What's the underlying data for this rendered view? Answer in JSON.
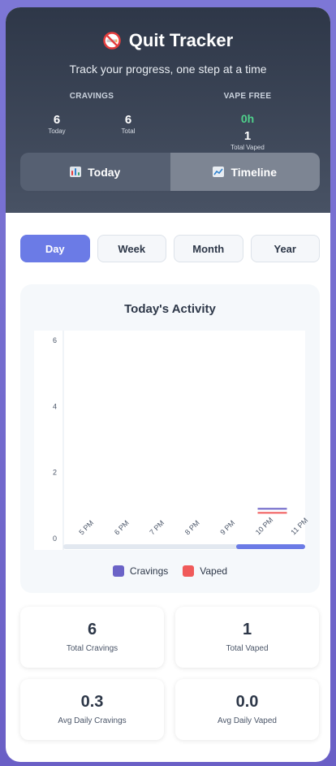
{
  "header": {
    "title": "Quit Tracker",
    "subtitle": "Track your progress, one step at a time",
    "cravings_label": "CRAVINGS",
    "vape_free_label": "VAPE FREE",
    "today_count": "6",
    "today_label": "Today",
    "total_count": "6",
    "total_label": "Total",
    "vape_free_time": "0h",
    "total_vaped_count": "1",
    "total_vaped_label": "Total Vaped"
  },
  "tabs": [
    {
      "label": "Today",
      "icon": "bar-chart-icon"
    },
    {
      "label": "Timeline",
      "icon": "line-chart-icon"
    }
  ],
  "ranges": [
    "Day",
    "Week",
    "Month",
    "Year"
  ],
  "active_range": "Day",
  "chart_data": {
    "type": "bar",
    "title": "Today's Activity",
    "categories": [
      "5 PM",
      "6 PM",
      "7 PM",
      "8 PM",
      "9 PM",
      "10 PM",
      "11 PM"
    ],
    "series": [
      {
        "name": "Cravings",
        "values": [
          0,
          0,
          0,
          0,
          0,
          1,
          0
        ],
        "color": "#6b63c7"
      },
      {
        "name": "Vaped",
        "values": [
          0,
          0,
          0,
          0,
          0,
          1,
          0
        ],
        "color": "#f05a5a"
      }
    ],
    "yticks": [
      "0",
      "2",
      "4",
      "6"
    ],
    "ylim": [
      0,
      6.5
    ],
    "grid": false
  },
  "stats": [
    {
      "value": "6",
      "label": "Total Cravings"
    },
    {
      "value": "1",
      "label": "Total Vaped"
    },
    {
      "value": "0.3",
      "label": "Avg Daily Cravings"
    },
    {
      "value": "0.0",
      "label": "Avg Daily Vaped"
    }
  ],
  "colors": {
    "accent": "#6b7be6",
    "vape_free_green": "#4fd18b"
  }
}
